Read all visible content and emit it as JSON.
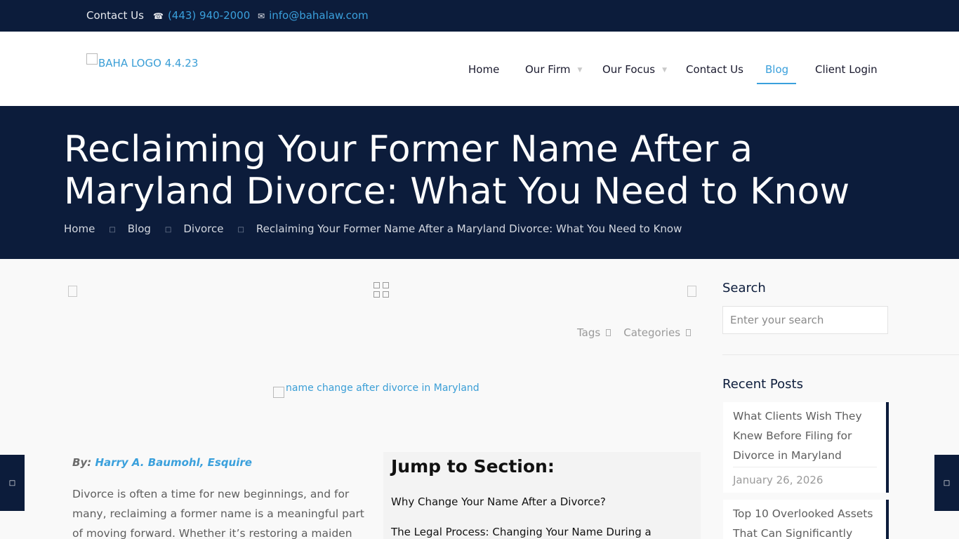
{
  "topbar": {
    "contact_label": "Contact Us",
    "phone": "(443) 940-2000",
    "email": "info@bahalaw.com",
    "phone_icon": "phone-icon",
    "email_icon": "envelope-icon"
  },
  "header": {
    "logo_alt": "BAHA LOGO 4.4.23",
    "nav": [
      {
        "label": "Home"
      },
      {
        "label": "Our Firm"
      },
      {
        "label": "Our Focus"
      },
      {
        "label": "Contact Us"
      },
      {
        "label": "Blog"
      },
      {
        "label": "Client Login"
      }
    ]
  },
  "hero": {
    "title": "Reclaiming Your Former Name After a Maryland Divorce: What You Need to Know",
    "breadcrumb": [
      "Home",
      "Blog",
      "Divorce",
      "Reclaiming Your Former Name After a Maryland Divorce: What You Need to Know"
    ]
  },
  "post": {
    "tags_label": "Tags",
    "categories_label": "Categories",
    "featured_alt": "name change after divorce in Maryland",
    "by_label": "By:",
    "author": "Harry A. Baumohl, Esquire",
    "intro": "Divorce is often a time for new beginnings, and for many, reclaiming a former name is a meaningful part of moving forward. Whether it’s restoring a maiden name"
  },
  "jump": {
    "title": "Jump to Section:",
    "items": [
      "Why Change Your Name After a Divorce?",
      "The Legal Process: Changing Your Name During a"
    ]
  },
  "sidebar": {
    "search_title": "Search",
    "search_placeholder": "Enter your search",
    "recent_title": "Recent Posts",
    "posts": [
      {
        "title": "What Clients Wish They Knew Before Filing for Divorce in Maryland",
        "date": "January 26, 2026"
      },
      {
        "title": "Top 10 Overlooked Assets That Can Significantly"
      }
    ]
  },
  "colors": {
    "navy": "#0c1c3b",
    "accent": "#3aa0dc"
  }
}
